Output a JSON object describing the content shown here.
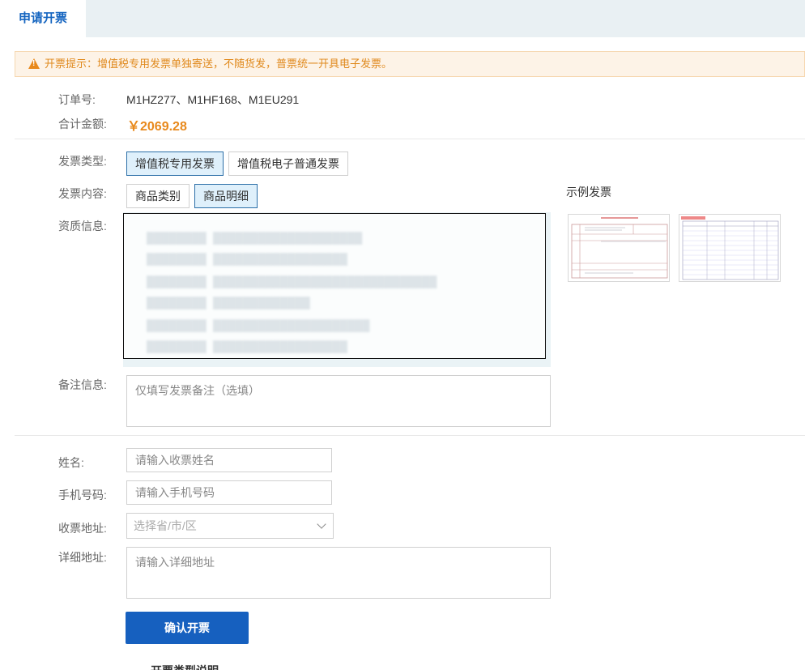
{
  "tab": {
    "label": "申请开票"
  },
  "notice": {
    "text": "开票提示：增值税专用发票单独寄送，不随货发，普票统一开具电子发票。"
  },
  "order": {
    "number_label": "订单号:",
    "number_value": "M1HZ277、M1HF168、M1EU291",
    "amount_label": "合计金额:",
    "amount_value": "￥2069.28"
  },
  "invoice": {
    "type_label": "发票类型:",
    "type_options": [
      "增值税专用发票",
      "增值税电子普通发票"
    ],
    "content_label": "发票内容:",
    "content_options": [
      "商品类别",
      "商品明细"
    ],
    "qualification_label": "资质信息:",
    "remark_label": "备注信息:",
    "remark_placeholder": "仅填写发票备注（选填）"
  },
  "recipient": {
    "name_label": "姓名:",
    "name_placeholder": "请输入收票姓名",
    "phone_label": "手机号码:",
    "phone_placeholder": "请输入手机号码",
    "region_label": "收票地址:",
    "region_placeholder": "选择省/市/区",
    "address_label": "详细地址:",
    "address_placeholder": "请输入详细地址"
  },
  "submit_label": "确认开票",
  "sample": {
    "title": "示例发票"
  },
  "bottom_heading": "开票类型说明"
}
